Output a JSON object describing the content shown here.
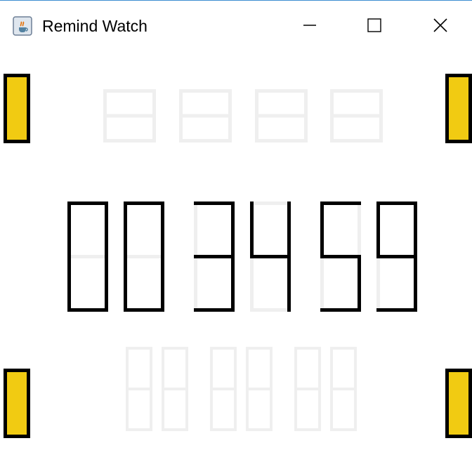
{
  "window": {
    "title": "Remind Watch",
    "icon": "java-cup-icon",
    "controls": [
      "minimize-icon",
      "maximize-icon",
      "close-icon"
    ]
  },
  "colors": {
    "segment_on": "#000000",
    "segment_off": "#efefef",
    "corner_indicator": "#f1cb12",
    "titlebar_accent": "#3c8ed1"
  },
  "display": {
    "top_row": {
      "digit_count": 4,
      "lit_segments": []
    },
    "main_row": {
      "digits": [
        "0",
        "0",
        "3",
        "4",
        "5",
        "9"
      ]
    },
    "bottom_row": {
      "digit_count": 6,
      "lit_segments": []
    }
  },
  "indicators": [
    "top-left",
    "top-right",
    "bottom-left",
    "bottom-right"
  ]
}
